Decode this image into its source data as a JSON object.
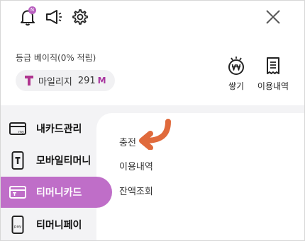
{
  "header": {
    "notification_badge": "N",
    "icons": [
      "bell-icon",
      "megaphone-icon",
      "gear-icon",
      "close-icon"
    ]
  },
  "member": {
    "grade_text": "등급 베이직(0% 적립)",
    "mileage_label": "마일리지",
    "mileage_value": "291",
    "mileage_unit": "M"
  },
  "quick_actions": [
    {
      "label": "쌓기",
      "icon": "won-coin-icon"
    },
    {
      "label": "이용내역",
      "icon": "receipt-icon"
    }
  ],
  "sidebar": {
    "items": [
      {
        "label": "내카드관리",
        "icon": "card-my-icon",
        "active": false
      },
      {
        "label": "모바일티머니",
        "icon": "mobile-t-icon",
        "active": false
      },
      {
        "label": "티머니카드",
        "icon": "card-t-icon",
        "active": true
      },
      {
        "label": "티머니페이",
        "icon": "mobile-pay-icon",
        "active": false
      }
    ]
  },
  "submenu": {
    "items": [
      "충전",
      "이용내역",
      "잔액조회"
    ]
  },
  "colors": {
    "accent": "#bf6ec8",
    "unit": "#a8349e",
    "arrow": "#e06a3c"
  }
}
